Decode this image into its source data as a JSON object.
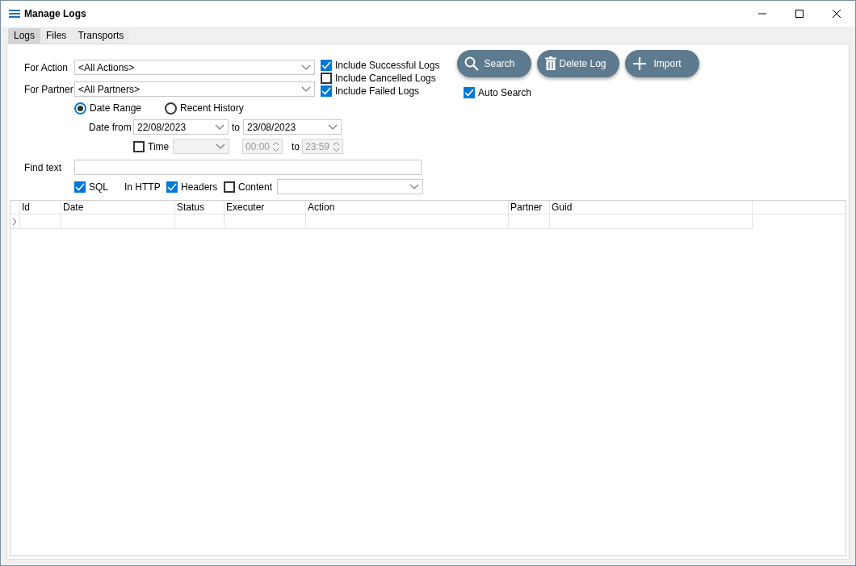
{
  "window": {
    "title": "Manage Logs"
  },
  "tabs": [
    {
      "label": "Logs",
      "selected": true
    },
    {
      "label": "Files",
      "selected": false
    },
    {
      "label": "Transports",
      "selected": false
    }
  ],
  "filters": {
    "action": {
      "label": "For Action",
      "value": "<All Actions>"
    },
    "partner": {
      "label": "For Partner",
      "value": "<All Partners>"
    },
    "includes": [
      {
        "label": "Include Successful Logs",
        "checked": true
      },
      {
        "label": "Include Cancelled Logs",
        "checked": false
      },
      {
        "label": "Include Failed Logs",
        "checked": true
      }
    ],
    "date_modes": [
      {
        "label": "Date Range",
        "selected": true
      },
      {
        "label": "Recent History",
        "selected": false
      }
    ],
    "date_from": {
      "label": "Date from",
      "value": "22/08/2023"
    },
    "date_to": {
      "label": "to",
      "value": "23/08/2023"
    },
    "time": {
      "label": "Time",
      "checked": false,
      "disabled": true,
      "from": "00:00",
      "to_label": "to",
      "to": "23:59"
    },
    "find_text": {
      "label": "Find text"
    },
    "search_in": {
      "sql": {
        "label": "SQL",
        "checked": true
      },
      "http_label": "In HTTP",
      "headers": {
        "label": "Headers",
        "checked": true
      },
      "content": {
        "label": "Content",
        "checked": false
      }
    }
  },
  "actions": [
    {
      "kind": "search",
      "label": "Search"
    },
    {
      "kind": "delete",
      "label": "Delete Log"
    },
    {
      "kind": "import",
      "label": "Import"
    }
  ],
  "auto_search": {
    "label": "Auto Search",
    "checked": true
  },
  "table": {
    "columns": [
      "Id",
      "Date",
      "Status",
      "Executer",
      "Action",
      "Partner",
      "Guid"
    ]
  }
}
